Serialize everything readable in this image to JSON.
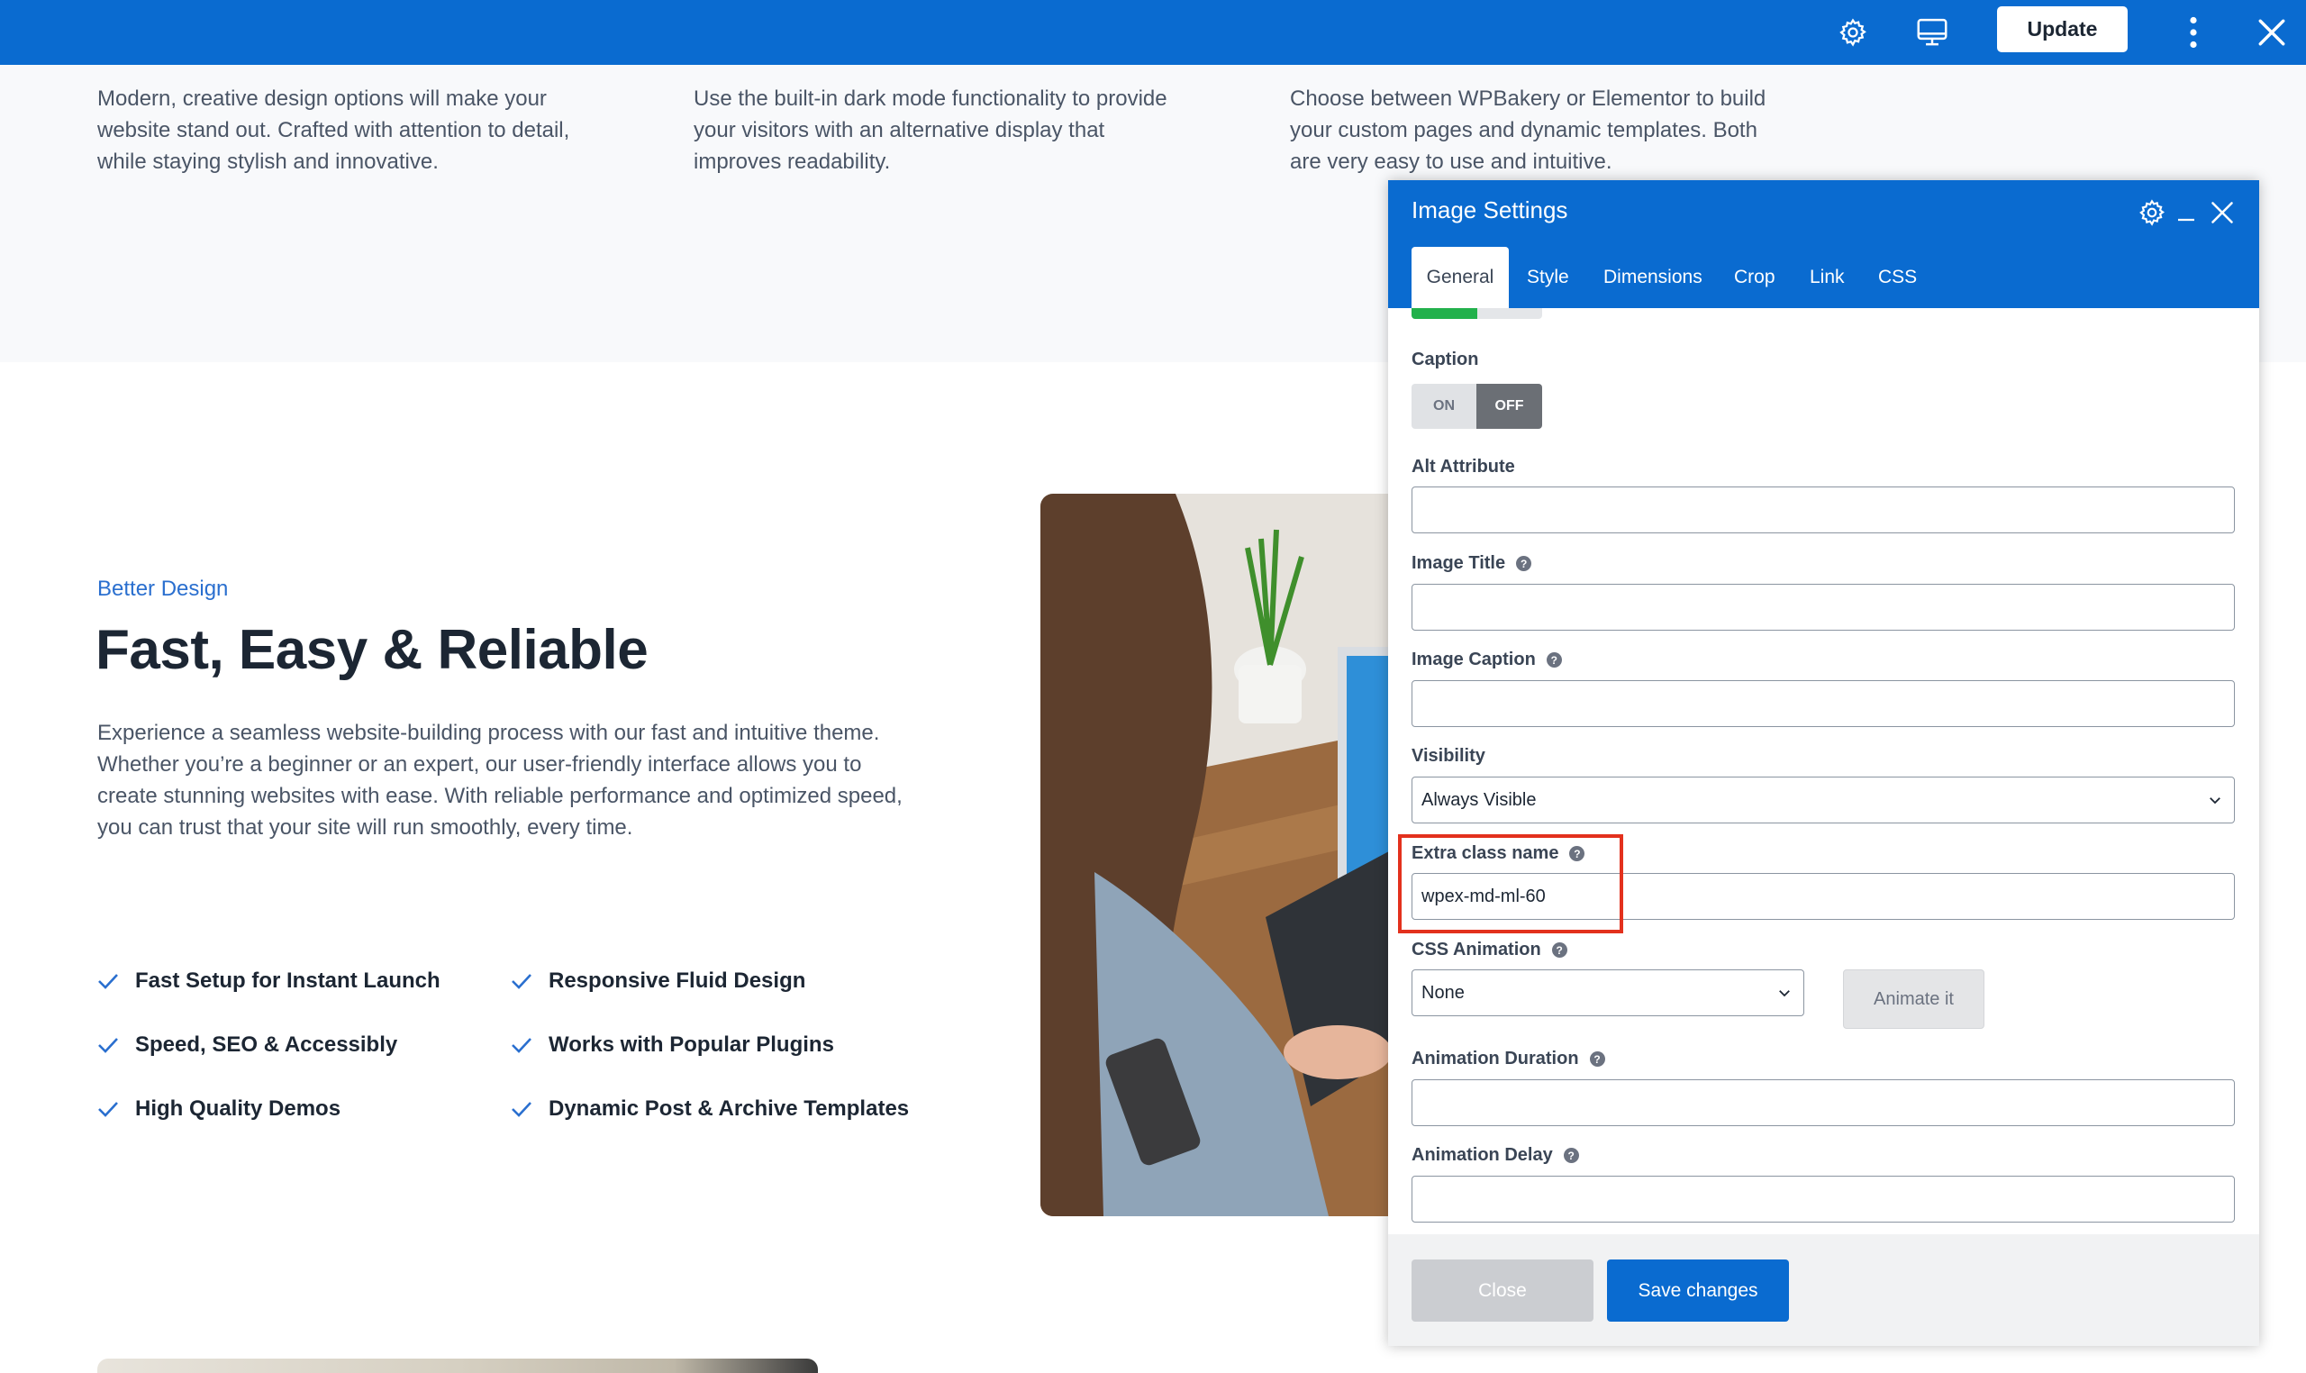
{
  "colors": {
    "brand_blue": "#0a6bd0",
    "accent_text_blue": "#2a6fcf",
    "success_green": "#22b14c",
    "highlight_red": "#e3311d"
  },
  "topbar": {
    "settings_icon": "gear-icon",
    "preview_icon": "desktop-monitor-icon",
    "update_label": "Update",
    "more_icon": "vertical-dots-icon",
    "close_icon": "close-icon"
  },
  "features": [
    {
      "text": "Modern, creative design options will make your website stand out. Crafted with attention to detail, while staying stylish and innovative."
    },
    {
      "text": "Use the built-in dark mode functionality to provide your visitors with an alternative display that improves readability."
    },
    {
      "text": "Choose between WPBakery or Elementor to build your custom pages and dynamic templates. Both are very easy to use and intuitive."
    }
  ],
  "section": {
    "eyebrow": "Better Design",
    "headline": "Fast, Easy & Reliable",
    "paragraph": "Experience a seamless website-building process with our fast and intuitive theme. Whether you’re a beginner or an expert, our user-friendly interface allows you to create stunning websites with ease. With reliable performance and optimized speed, you can trust that your site will run smoothly, every time.",
    "checklist": [
      "Fast Setup for Instant Launch",
      "Responsive Fluid Design",
      "Speed, SEO & Accessibly",
      "Works with Popular Plugins",
      "High Quality Demos",
      "Dynamic Post & Archive Templates"
    ]
  },
  "modal": {
    "title": "Image Settings",
    "header_icons": [
      "gear-icon",
      "minimize-icon",
      "close-icon"
    ],
    "tabs": [
      "General",
      "Style",
      "Dimensions",
      "Crop",
      "Link",
      "CSS"
    ],
    "active_tab": "General",
    "caption_label": "Caption",
    "toggle_on": "ON",
    "toggle_off": "OFF",
    "toggle_state": "OFF",
    "alt_label": "Alt Attribute",
    "alt_value": "",
    "image_title_label": "Image Title",
    "image_title_value": "",
    "image_caption_label": "Image Caption",
    "image_caption_value": "",
    "visibility_label": "Visibility",
    "visibility_value": "Always Visible",
    "extra_class_label": "Extra class name",
    "extra_class_value": "wpex-md-ml-60",
    "css_animation_label": "CSS Animation",
    "css_animation_value": "None",
    "animate_button": "Animate it",
    "anim_duration_label": "Animation Duration",
    "anim_duration_value": "",
    "anim_delay_label": "Animation Delay",
    "anim_delay_value": "",
    "close_button": "Close",
    "save_button": "Save changes"
  }
}
